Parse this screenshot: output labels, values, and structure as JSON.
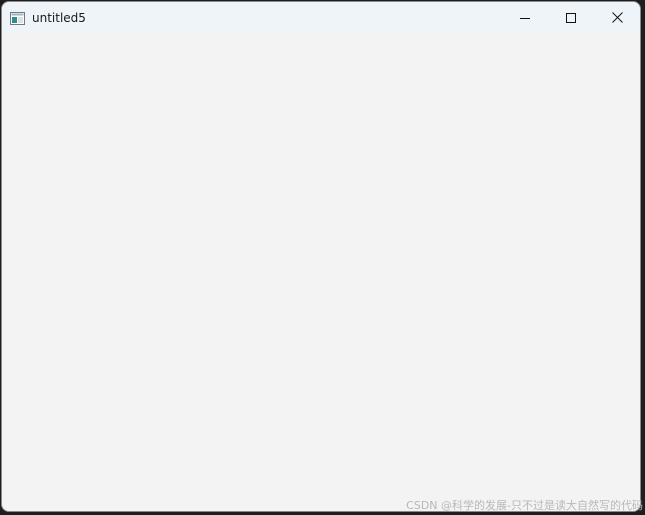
{
  "window": {
    "title": "untitled5",
    "icon": "app-window-icon"
  },
  "titlebar": {
    "minimize_icon": "minimize-icon",
    "maximize_icon": "maximize-icon",
    "close_icon": "close-icon"
  },
  "watermark": {
    "text": "CSDN @科学的发展-只不过是读大自然写的代码"
  }
}
